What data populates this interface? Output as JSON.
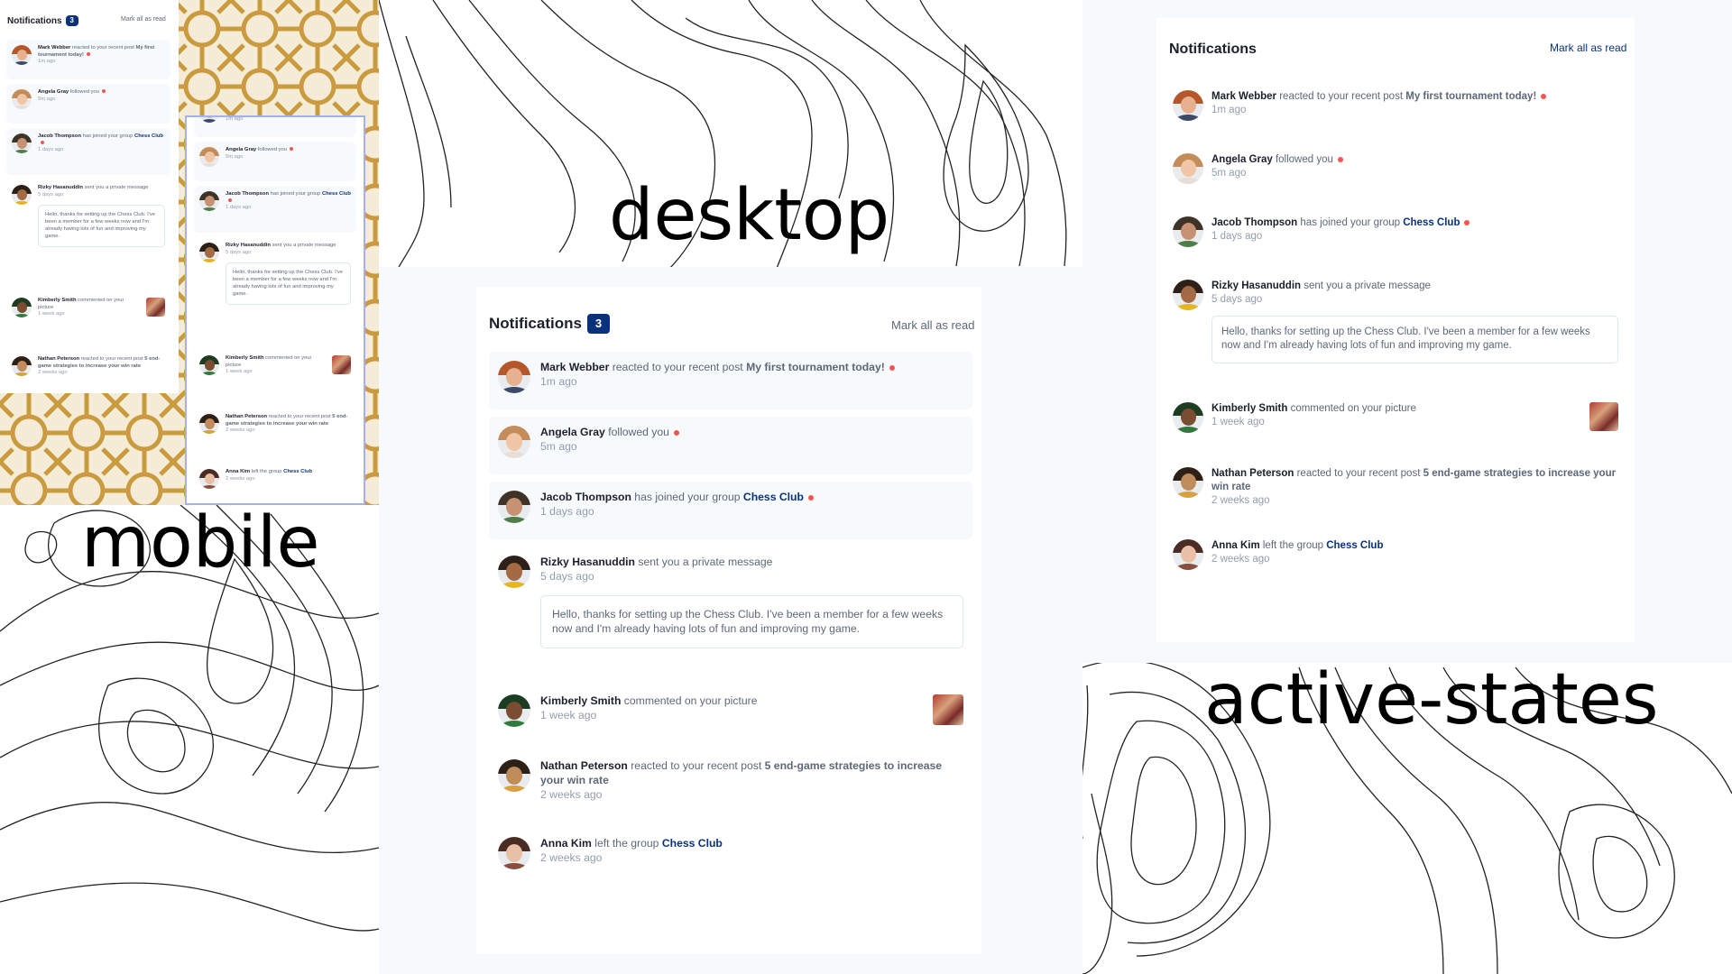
{
  "labels": {
    "desktop": "desktop",
    "mobile": "mobile",
    "active": "active-states"
  },
  "colors": {
    "dark_blue": "#0a317b",
    "red_dot": "#f65552",
    "very_dark": "#1c202b",
    "grayish_blue": "#5e6778",
    "light_grayish": "#939cad",
    "light_bg": "#f7fafd",
    "lattice_gold": "#c99a3e"
  },
  "header": {
    "title": "Notifications",
    "count": "3",
    "mark_all": "Mark all as read"
  },
  "notifications": [
    {
      "actor": "Mark Webber",
      "action": "reacted to your recent post",
      "post": "My first tournament today!",
      "group": "",
      "time": "1m ago",
      "unread": true,
      "message": "",
      "has_thumb": false
    },
    {
      "actor": "Angela Gray",
      "action": "followed you",
      "post": "",
      "group": "",
      "time": "5m ago",
      "unread": true,
      "message": "",
      "has_thumb": false
    },
    {
      "actor": "Jacob Thompson",
      "action": "has joined your group",
      "post": "",
      "group": "Chess Club",
      "time": "1 days ago",
      "unread": true,
      "message": "",
      "has_thumb": false
    },
    {
      "actor": "Rizky Hasanuddin",
      "action": "sent you a private message",
      "post": "",
      "group": "",
      "time": "5 days ago",
      "unread": false,
      "message": "Hello, thanks for setting up the Chess Club. I've been a member for a few weeks now and I'm already having lots of fun and improving my game.",
      "has_thumb": false
    },
    {
      "actor": "Kimberly Smith",
      "action": "commented on your picture",
      "post": "",
      "group": "",
      "time": "1 week ago",
      "unread": false,
      "message": "",
      "has_thumb": true
    },
    {
      "actor": "Nathan Peterson",
      "action": "reacted to your recent post",
      "post": "5 end-game strategies to increase your win rate",
      "group": "",
      "time": "2 weeks ago",
      "unread": false,
      "message": "",
      "has_thumb": false
    },
    {
      "actor": "Anna Kim",
      "action": "left the group",
      "post": "",
      "group": "Chess Club",
      "time": "2 weeks ago",
      "unread": false,
      "message": "",
      "has_thumb": false
    }
  ],
  "avatars": [
    {
      "icon": "avatar-mark-webber",
      "skin": "#e7b08f",
      "hair": "#b5562b",
      "shirt": "#3c4a6a"
    },
    {
      "icon": "avatar-angela-gray",
      "skin": "#f0c6a6",
      "hair": "#c48c58",
      "shirt": "#e8ded3"
    },
    {
      "icon": "avatar-jacob-thompson",
      "skin": "#c79274",
      "hair": "#3e3326",
      "shirt": "#4f7d4a"
    },
    {
      "icon": "avatar-rizky-hasanuddin",
      "skin": "#a36a44",
      "hair": "#2c2018",
      "shirt": "#e6b621"
    },
    {
      "icon": "avatar-kimberly-smith",
      "skin": "#7a4c32",
      "hair": "#1d3d22",
      "shirt": "#2f7a3c"
    },
    {
      "icon": "avatar-nathan-peterson",
      "skin": "#c08c5c",
      "hair": "#2d2016",
      "shirt": "#d8a040"
    },
    {
      "icon": "avatar-anna-kim",
      "skin": "#e9bfa5",
      "hair": "#4b2c25",
      "shirt": "#8a4e3e"
    }
  ]
}
